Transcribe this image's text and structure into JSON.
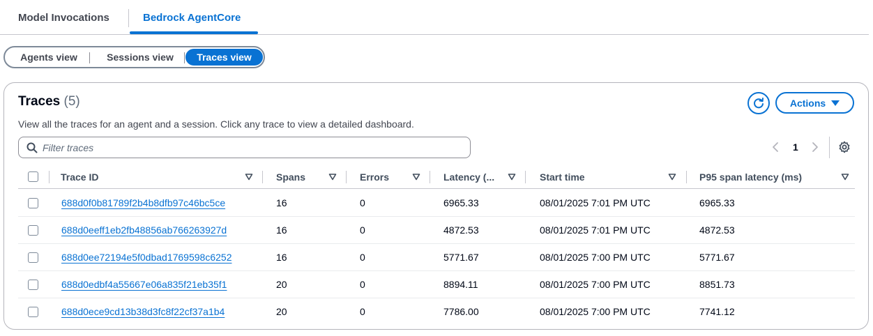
{
  "top_tabs": [
    "Model Invocations",
    "Bedrock AgentCore"
  ],
  "view_segments": [
    "Agents view",
    "Sessions view",
    "Traces view"
  ],
  "selected_segment": "Traces view",
  "traces": {
    "title": "Traces",
    "count": "(5)",
    "description": "View all the traces for an agent and a session. Click any trace to view a detailed dashboard.",
    "actions_label": "Actions",
    "filter_placeholder": "Filter traces",
    "page": "1",
    "columns": [
      "Trace ID",
      "Spans",
      "Errors",
      "Latency (...",
      "Start time",
      "P95 span latency (ms)"
    ],
    "rows": [
      {
        "trace_id": "688d0f0b81789f2b4b8dfb97c46bc5ce",
        "spans": "16",
        "errors": "0",
        "latency": "6965.33",
        "start_time": "08/01/2025 7:01 PM UTC",
        "p95": "6965.33"
      },
      {
        "trace_id": "688d0eeff1eb2fb48856ab766263927d",
        "spans": "16",
        "errors": "0",
        "latency": "4872.53",
        "start_time": "08/01/2025 7:01 PM UTC",
        "p95": "4872.53"
      },
      {
        "trace_id": "688d0ee72194e5f0dbad1769598c6252",
        "spans": "16",
        "errors": "0",
        "latency": "5771.67",
        "start_time": "08/01/2025 7:00 PM UTC",
        "p95": "5771.67"
      },
      {
        "trace_id": "688d0edbf4a55667e06a835f21eb35f1",
        "spans": "20",
        "errors": "0",
        "latency": "8894.11",
        "start_time": "08/01/2025 7:00 PM UTC",
        "p95": "8851.73"
      },
      {
        "trace_id": "688d0ece9cd13b38d3fc8f22cf37a1b4",
        "spans": "20",
        "errors": "0",
        "latency": "7786.00",
        "start_time": "08/01/2025 7:00 PM UTC",
        "p95": "7741.12"
      }
    ]
  },
  "colors": {
    "accent": "#0972d3",
    "text": "#000716",
    "muted": "#5f6b7a",
    "border": "#c6c6cd"
  },
  "icons": [
    "refresh-icon",
    "caret-down-icon",
    "search-icon",
    "chevron-left-icon",
    "chevron-right-icon",
    "settings-gear-icon",
    "sort-icon"
  ]
}
